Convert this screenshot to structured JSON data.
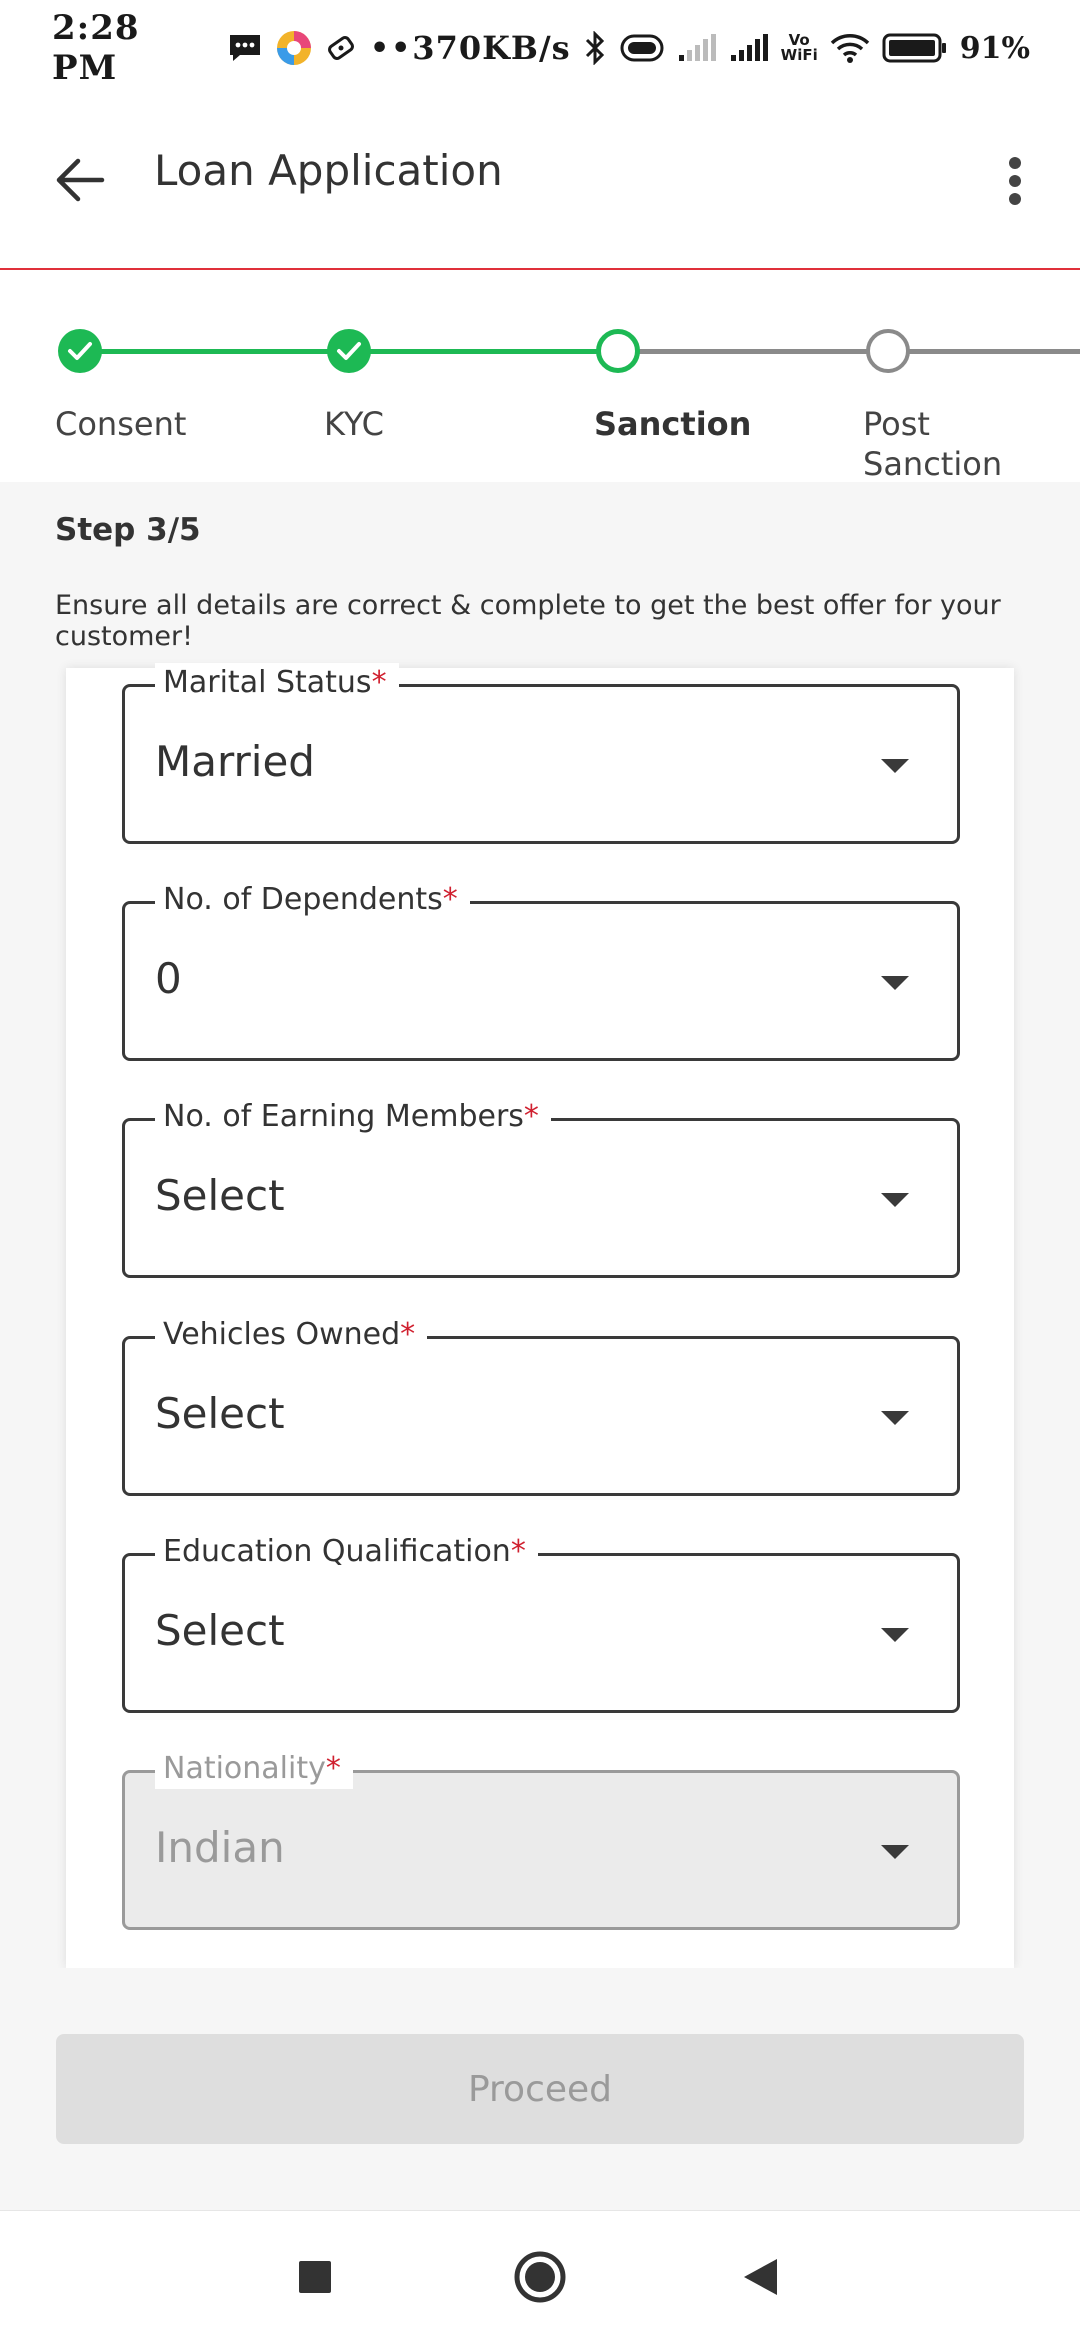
{
  "status_bar": {
    "time": "2:28 PM",
    "dots": "••",
    "net_speed": "370KB/s",
    "vowifi_top": "Vo",
    "vowifi_bottom": "WiFi",
    "battery": "91%",
    "icons": [
      "message-icon",
      "app-icon",
      "game-icon",
      "bluetooth-icon",
      "vibrate-icon",
      "signal-icon",
      "signal-icon",
      "vowifi-icon",
      "wifi-icon",
      "battery-icon"
    ]
  },
  "app_bar": {
    "title": "Loan Application",
    "back_icon": "arrow-left-icon",
    "more_icon": "more-vertical-icon"
  },
  "stepper": {
    "steps": [
      {
        "label": "Consent",
        "state": "done"
      },
      {
        "label": "KYC",
        "state": "done"
      },
      {
        "label": "Sanction",
        "state": "active"
      },
      {
        "label_line1": "Post",
        "label_line2": "Sanction",
        "state": "todo"
      }
    ],
    "accent": "#1db954"
  },
  "info": {
    "step_count": "Step 3/5",
    "message": "Ensure all details are correct & complete to get the best offer for your customer!"
  },
  "form": {
    "fields": [
      {
        "label": "Marital Status",
        "required": "*",
        "value": "Married"
      },
      {
        "label": "No. of Dependents",
        "required": "*",
        "value": "0"
      },
      {
        "label": "No. of Earning Members",
        "required": "*",
        "value": "Select"
      },
      {
        "label": "Vehicles Owned",
        "required": "*",
        "value": "Select"
      },
      {
        "label": "Education Qualification",
        "required": "*",
        "value": "Select"
      },
      {
        "label": "Nationality",
        "required": "*",
        "value": "Indian",
        "disabled": true
      }
    ]
  },
  "actions": {
    "proceed_label": "Proceed"
  },
  "colors": {
    "required": "#d0202f",
    "appbar_divider": "#e0303a"
  }
}
